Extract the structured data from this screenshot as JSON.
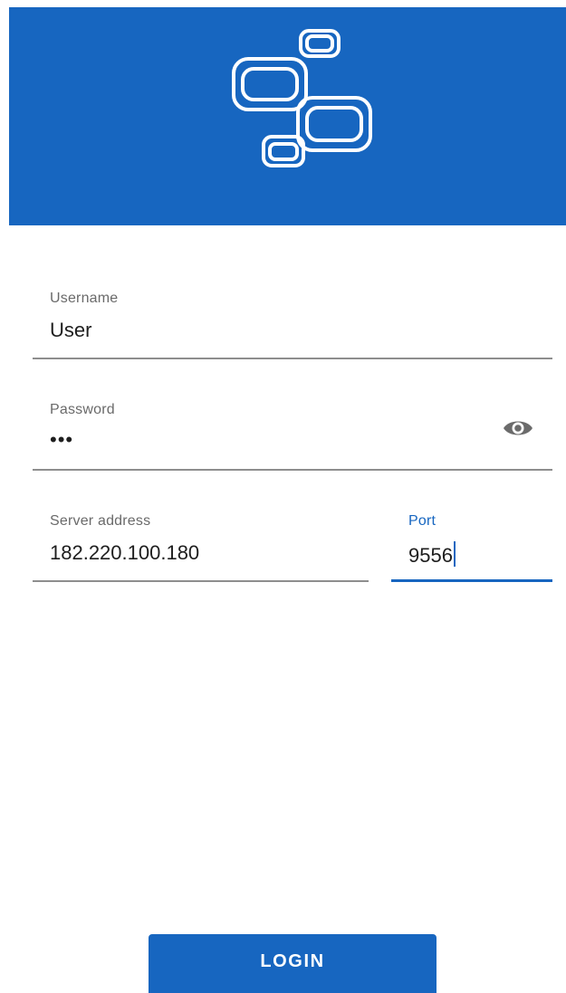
{
  "app": {
    "logo_icon": "linked-rounded-rectangles-logo",
    "header_color": "#1766c0"
  },
  "form": {
    "username": {
      "label": "Username",
      "value": "User"
    },
    "password": {
      "label": "Password",
      "value_masked": "•••",
      "toggle_icon": "eye-icon"
    },
    "server": {
      "label": "Server address",
      "value": "182.220.100.180"
    },
    "port": {
      "label": "Port",
      "value": "9556"
    }
  },
  "actions": {
    "login_label": "LOGIN"
  }
}
